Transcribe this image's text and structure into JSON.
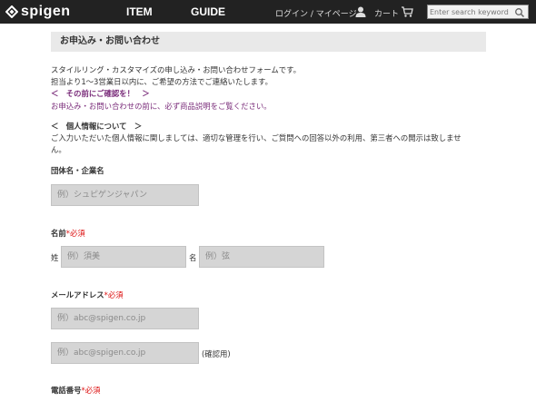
{
  "header": {
    "logo_text": "spigen",
    "nav": [
      "ITEM",
      "GUIDE"
    ],
    "login_label": "ログイン / マイページ",
    "cart_label": "カート",
    "search_placeholder": "Enter search keyword",
    "icons": [
      "spigen-logo-icon",
      "user-icon",
      "cart-icon",
      "search-icon"
    ]
  },
  "page": {
    "section_title": "お申込み・お問い合わせ",
    "intro_line1": "スタイルリング・カスタマイズの申し込み・お問い合わせフォームです。",
    "intro_line2": "担当より1～3営業日以内に、ご希望の方法でご連絡いたします。",
    "confirm_heading": "＜　その前にご確認を！　＞",
    "confirm_text": "お申込み・お問い合わせの前に、必ず商品説明をご覧ください。",
    "privacy_heading": "＜　個人情報について　＞",
    "privacy_text": "ご入力いただいた個人情報に関しましては、適切な管理を行い、ご質問への回答以外の利用、第三者への開示は致しませ",
    "privacy_text2": "ん。"
  },
  "form": {
    "company_label": "団体名・企業名",
    "company_placeholder": "例）シュピゲンジャパン",
    "name_label": "名前",
    "required_mark": "*必須",
    "sei_label": "姓",
    "sei_placeholder": "例）須美",
    "mei_label": "名",
    "mei_placeholder": "例）弦",
    "email_label": "メールアドレス",
    "email_placeholder": "例）abc@spigen.co.jp",
    "email_confirm_placeholder": "例）abc@spigen.co.jp",
    "email_confirm_note": "(確認用)",
    "phone_label": "電話番号"
  }
}
